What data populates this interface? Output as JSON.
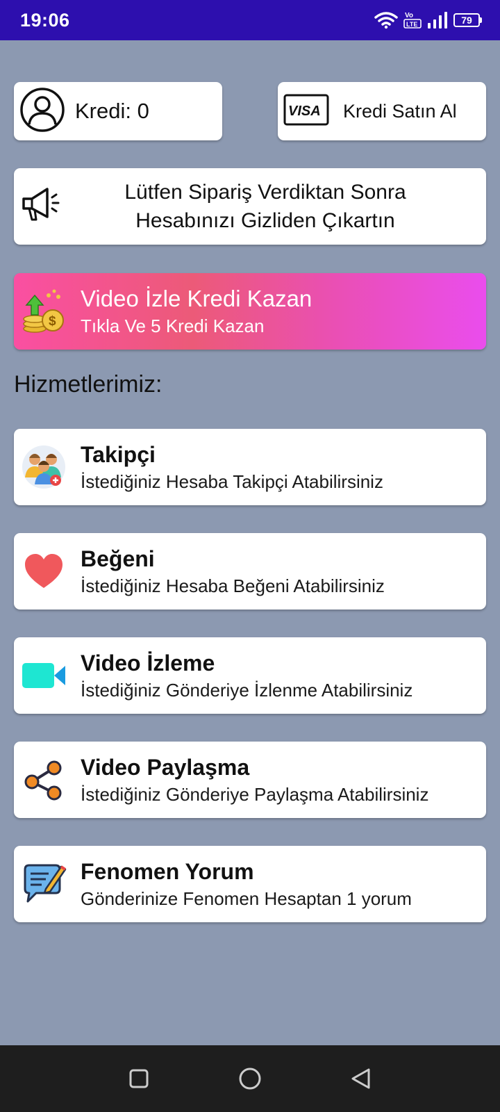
{
  "status_bar": {
    "time": "19:06",
    "battery": "79"
  },
  "credit": {
    "label": "Kredi: 0"
  },
  "buy": {
    "label": "Kredi Satın Al",
    "card_logo": "VISA"
  },
  "notice": {
    "line1": "Lütfen Sipariş Verdiktan Sonra",
    "line2": "Hesabınızı Gizliden Çıkartın"
  },
  "reward": {
    "title": "Video İzle Kredi Kazan",
    "subtitle": "Tıkla Ve 5 Kredi Kazan"
  },
  "services_heading": "Hizmetlerimiz:",
  "services": [
    {
      "title": "Takipçi",
      "desc": "İstediğiniz Hesaba Takipçi Atabilirsiniz",
      "icon": "followers-icon"
    },
    {
      "title": "Beğeni",
      "desc": "İstediğiniz Hesaba Beğeni Atabilirsiniz",
      "icon": "heart-icon"
    },
    {
      "title": "Video İzleme",
      "desc": "İstediğiniz Gönderiye İzlenme Atabilirsiniz",
      "icon": "video-camera-icon"
    },
    {
      "title": "Video Paylaşma",
      "desc": "İstediğiniz Gönderiye Paylaşma Atabilirsiniz",
      "icon": "share-icon"
    },
    {
      "title": "Fenomen Yorum",
      "desc": "Gönderinize Fenomen Hesaptan 1 yorum",
      "icon": "comment-icon"
    }
  ],
  "colors": {
    "status_bar": "#2d0fae",
    "background": "#8c99b1",
    "reward_gradient_start": "#fa4fa2",
    "reward_gradient_end": "#ea4ded",
    "video_icon": "#1ee6d2",
    "heart_icon": "#f0585c",
    "share_icon": "#f08a24"
  }
}
